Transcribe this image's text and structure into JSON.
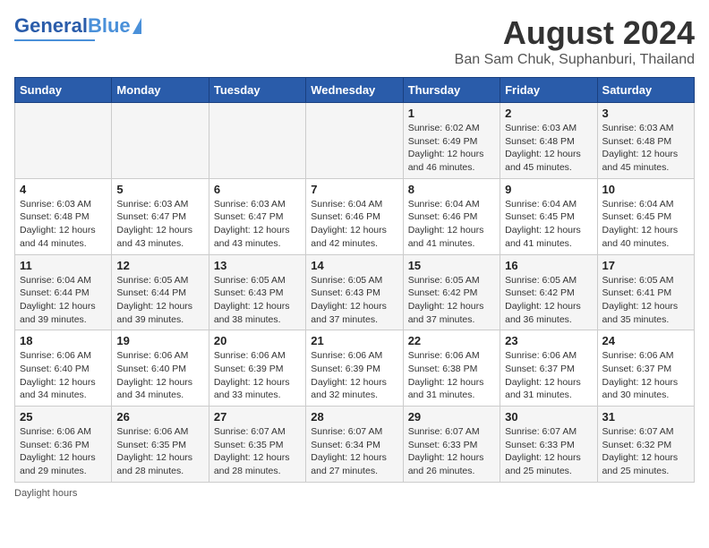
{
  "header": {
    "logo_general": "General",
    "logo_blue": "Blue",
    "main_title": "August 2024",
    "subtitle": "Ban Sam Chuk, Suphanburi, Thailand"
  },
  "calendar": {
    "days_of_week": [
      "Sunday",
      "Monday",
      "Tuesday",
      "Wednesday",
      "Thursday",
      "Friday",
      "Saturday"
    ],
    "weeks": [
      [
        {
          "day": "",
          "info": ""
        },
        {
          "day": "",
          "info": ""
        },
        {
          "day": "",
          "info": ""
        },
        {
          "day": "",
          "info": ""
        },
        {
          "day": "1",
          "info": "Sunrise: 6:02 AM\nSunset: 6:49 PM\nDaylight: 12 hours and 46 minutes."
        },
        {
          "day": "2",
          "info": "Sunrise: 6:03 AM\nSunset: 6:48 PM\nDaylight: 12 hours and 45 minutes."
        },
        {
          "day": "3",
          "info": "Sunrise: 6:03 AM\nSunset: 6:48 PM\nDaylight: 12 hours and 45 minutes."
        }
      ],
      [
        {
          "day": "4",
          "info": "Sunrise: 6:03 AM\nSunset: 6:48 PM\nDaylight: 12 hours and 44 minutes."
        },
        {
          "day": "5",
          "info": "Sunrise: 6:03 AM\nSunset: 6:47 PM\nDaylight: 12 hours and 43 minutes."
        },
        {
          "day": "6",
          "info": "Sunrise: 6:03 AM\nSunset: 6:47 PM\nDaylight: 12 hours and 43 minutes."
        },
        {
          "day": "7",
          "info": "Sunrise: 6:04 AM\nSunset: 6:46 PM\nDaylight: 12 hours and 42 minutes."
        },
        {
          "day": "8",
          "info": "Sunrise: 6:04 AM\nSunset: 6:46 PM\nDaylight: 12 hours and 41 minutes."
        },
        {
          "day": "9",
          "info": "Sunrise: 6:04 AM\nSunset: 6:45 PM\nDaylight: 12 hours and 41 minutes."
        },
        {
          "day": "10",
          "info": "Sunrise: 6:04 AM\nSunset: 6:45 PM\nDaylight: 12 hours and 40 minutes."
        }
      ],
      [
        {
          "day": "11",
          "info": "Sunrise: 6:04 AM\nSunset: 6:44 PM\nDaylight: 12 hours and 39 minutes."
        },
        {
          "day": "12",
          "info": "Sunrise: 6:05 AM\nSunset: 6:44 PM\nDaylight: 12 hours and 39 minutes."
        },
        {
          "day": "13",
          "info": "Sunrise: 6:05 AM\nSunset: 6:43 PM\nDaylight: 12 hours and 38 minutes."
        },
        {
          "day": "14",
          "info": "Sunrise: 6:05 AM\nSunset: 6:43 PM\nDaylight: 12 hours and 37 minutes."
        },
        {
          "day": "15",
          "info": "Sunrise: 6:05 AM\nSunset: 6:42 PM\nDaylight: 12 hours and 37 minutes."
        },
        {
          "day": "16",
          "info": "Sunrise: 6:05 AM\nSunset: 6:42 PM\nDaylight: 12 hours and 36 minutes."
        },
        {
          "day": "17",
          "info": "Sunrise: 6:05 AM\nSunset: 6:41 PM\nDaylight: 12 hours and 35 minutes."
        }
      ],
      [
        {
          "day": "18",
          "info": "Sunrise: 6:06 AM\nSunset: 6:40 PM\nDaylight: 12 hours and 34 minutes."
        },
        {
          "day": "19",
          "info": "Sunrise: 6:06 AM\nSunset: 6:40 PM\nDaylight: 12 hours and 34 minutes."
        },
        {
          "day": "20",
          "info": "Sunrise: 6:06 AM\nSunset: 6:39 PM\nDaylight: 12 hours and 33 minutes."
        },
        {
          "day": "21",
          "info": "Sunrise: 6:06 AM\nSunset: 6:39 PM\nDaylight: 12 hours and 32 minutes."
        },
        {
          "day": "22",
          "info": "Sunrise: 6:06 AM\nSunset: 6:38 PM\nDaylight: 12 hours and 31 minutes."
        },
        {
          "day": "23",
          "info": "Sunrise: 6:06 AM\nSunset: 6:37 PM\nDaylight: 12 hours and 31 minutes."
        },
        {
          "day": "24",
          "info": "Sunrise: 6:06 AM\nSunset: 6:37 PM\nDaylight: 12 hours and 30 minutes."
        }
      ],
      [
        {
          "day": "25",
          "info": "Sunrise: 6:06 AM\nSunset: 6:36 PM\nDaylight: 12 hours and 29 minutes."
        },
        {
          "day": "26",
          "info": "Sunrise: 6:06 AM\nSunset: 6:35 PM\nDaylight: 12 hours and 28 minutes."
        },
        {
          "day": "27",
          "info": "Sunrise: 6:07 AM\nSunset: 6:35 PM\nDaylight: 12 hours and 28 minutes."
        },
        {
          "day": "28",
          "info": "Sunrise: 6:07 AM\nSunset: 6:34 PM\nDaylight: 12 hours and 27 minutes."
        },
        {
          "day": "29",
          "info": "Sunrise: 6:07 AM\nSunset: 6:33 PM\nDaylight: 12 hours and 26 minutes."
        },
        {
          "day": "30",
          "info": "Sunrise: 6:07 AM\nSunset: 6:33 PM\nDaylight: 12 hours and 25 minutes."
        },
        {
          "day": "31",
          "info": "Sunrise: 6:07 AM\nSunset: 6:32 PM\nDaylight: 12 hours and 25 minutes."
        }
      ]
    ]
  },
  "footer": {
    "daylight_hours_label": "Daylight hours"
  }
}
